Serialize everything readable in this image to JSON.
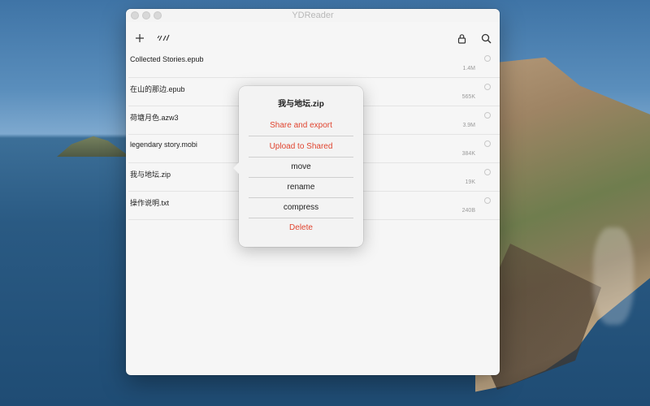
{
  "window": {
    "title": "YDReader"
  },
  "toolbar": {
    "add_icon": "plus-icon",
    "edit_icon": "edit-tools-icon",
    "lock_icon": "lock-icon",
    "search_icon": "search-icon"
  },
  "files": [
    {
      "name": "Collected Stories.epub",
      "size": "1.4M"
    },
    {
      "name": "在山的那边.epub",
      "size": "565K"
    },
    {
      "name": "荷塘月色.azw3",
      "size": "3.9M"
    },
    {
      "name": "legendary story.mobi",
      "size": "384K"
    },
    {
      "name": "我与地坛.zip",
      "size": "19K"
    },
    {
      "name": "操作说明.txt",
      "size": "240B"
    }
  ],
  "popover": {
    "title": "我与地坛.zip",
    "items": [
      {
        "label": "Share and export"
      },
      {
        "label": "Upload to Shared"
      },
      {
        "label": "move"
      },
      {
        "label": "rename"
      },
      {
        "label": "compress"
      },
      {
        "label": "Delete"
      }
    ]
  },
  "colors": {
    "destructive": "#e0442f",
    "window_bg": "#f6f6f6"
  }
}
